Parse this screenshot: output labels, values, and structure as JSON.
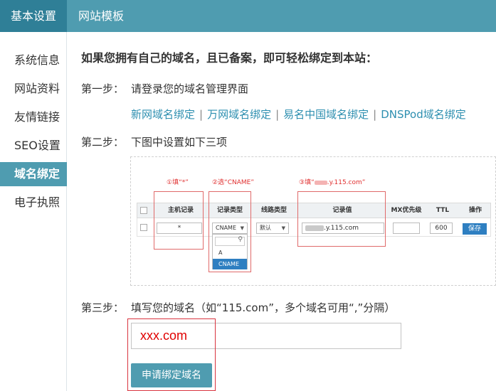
{
  "tabs": {
    "basic": "基本设置",
    "template": "网站模板"
  },
  "sidebar": {
    "items": [
      {
        "label": "系统信息"
      },
      {
        "label": "网站资料"
      },
      {
        "label": "友情链接"
      },
      {
        "label": "SEO设置"
      },
      {
        "label": "域名绑定",
        "active": true
      },
      {
        "label": "电子执照"
      }
    ]
  },
  "main": {
    "intro": "如果您拥有自己的域名，且已备案，即可轻松绑定到本站：",
    "step1": {
      "label": "第一步：",
      "text": "请登录您的域名管理界面"
    },
    "registrars": [
      "新网域名绑定",
      "万网域名绑定",
      "易名中国域名绑定",
      "DNSPod域名绑定"
    ],
    "separator": "|",
    "step2": {
      "label": "第二步：",
      "text": "下图中设置如下三项"
    },
    "step3": {
      "label": "第三步：",
      "text": "填写您的域名（如“115.com”，多个域名可用“,”分隔）"
    },
    "domain_input_value": "xxx.com",
    "submit_label": "申请绑定域名"
  },
  "illustration": {
    "annotations": [
      "①填“*”",
      "②选“CNAME”",
      "③填“",
      ".y.115.com”"
    ],
    "columns": [
      "主机记录",
      "记录类型",
      "线路类型",
      "记录值",
      "MX优先级",
      "TTL",
      "操作"
    ],
    "row": {
      "host": "*",
      "type": "CNAME",
      "line": "默认",
      "value_suffix": ".y.115.com",
      "ttl": "600",
      "save": "保存"
    },
    "dropdown_options": [
      "A",
      "CNAME"
    ],
    "colors": {
      "annotation": "#e03030",
      "save_button": "#2e7fc1"
    }
  },
  "colors": {
    "accent": "#4f9cb0",
    "accent_dark": "#2f7f97",
    "link": "#2e8fb0",
    "input_text": "#e00000"
  }
}
